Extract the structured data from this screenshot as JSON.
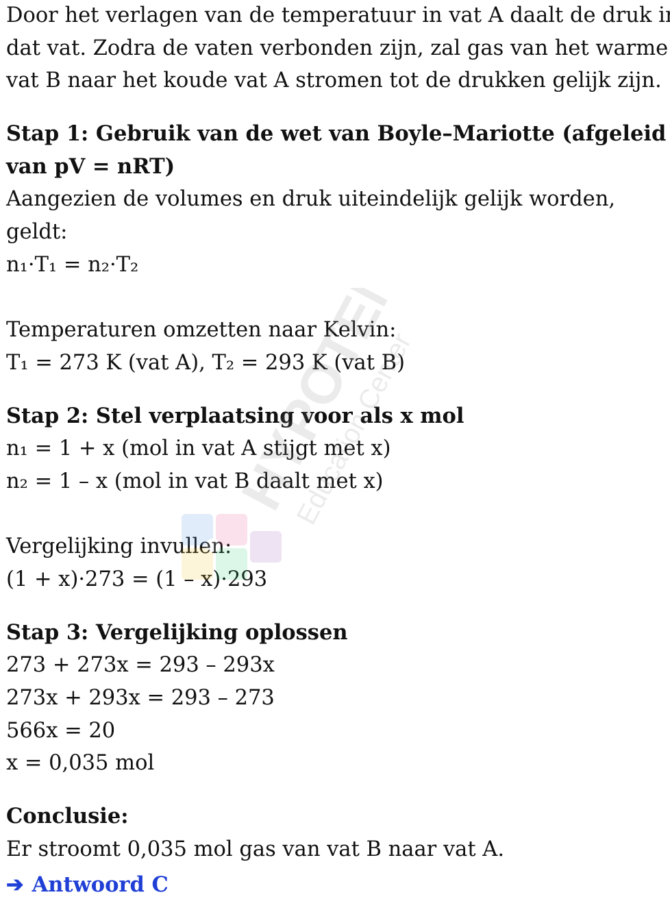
{
  "intro": [
    "Door het verlagen van de temperatuur in vat A daalt de druk in",
    "dat vat. Zodra de vaten verbonden zijn, zal gas van het warme",
    "vat B naar het koude vat A stromen tot de drukken gelijk zijn."
  ],
  "step1": {
    "heading_line1": "Stap 1: Gebruik van de wet van Boyle–Mariotte (afgeleid",
    "heading_line2": "van pV = nRT)",
    "text_line1": "Aangezien de volumes en druk uiteindelijk gelijk worden,",
    "text_line2": "geldt:",
    "formula": "n₁·T₁ = n₂·T₂",
    "kelvin_label": "Temperaturen omzetten naar Kelvin:",
    "kelvin_values": "T₁ = 273 K (vat A), T₂ = 293 K (vat B)"
  },
  "step2": {
    "heading": "Stap 2: Stel verplaatsing voor als x mol",
    "n1": "n₁ = 1 + x (mol in vat A stijgt met x)",
    "n2": "n₂ = 1 – x (mol in vat B daalt met x)",
    "fill_label": "Vergelijking invullen:",
    "equation": "(1 + x)·273 = (1 – x)·293"
  },
  "step3": {
    "heading": "Stap 3: Vergelijking oplossen",
    "lines": [
      "273 + 273x = 293 – 293x",
      "273x + 293x = 293 – 273",
      "566x = 20",
      "x = 0,035 mol"
    ]
  },
  "conclusion": {
    "heading": "Conclusie:",
    "text": "Er stroomt 0,035 mol gas van vat B naar vat A.",
    "arrow": "➔",
    "answer": "Antwoord C"
  },
  "watermark": {
    "brand": "HYPOTENUSE",
    "sub": "Education Center"
  },
  "colors": {
    "answer": "#1f3fd6",
    "text": "#111111"
  }
}
